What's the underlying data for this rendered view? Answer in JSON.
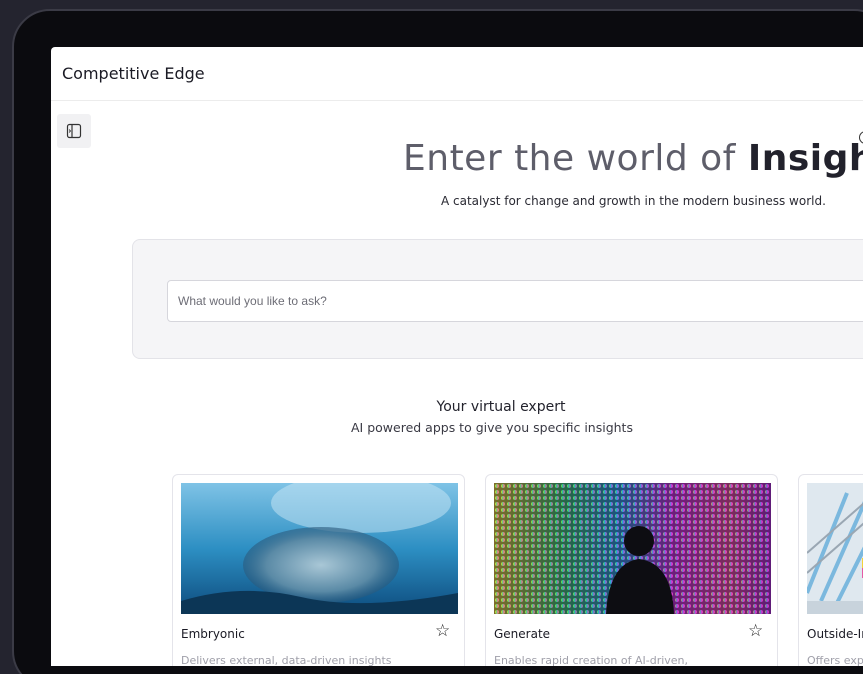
{
  "app": {
    "title": "Competitive Edge"
  },
  "sidebar": {
    "toggle_icon": "sidebar-panel-icon"
  },
  "hero": {
    "title_prefix": "Enter the world of ",
    "title_emphasis": "Insights",
    "info_icon": "info-icon",
    "info_glyph": "i",
    "subtitle": "A catalyst for change and growth in the modern business world."
  },
  "search": {
    "placeholder": "What would you like to ask?",
    "value": ""
  },
  "section": {
    "title": "Your virtual expert",
    "subtitle": "AI powered apps to give you specific insights"
  },
  "cards": [
    {
      "name": "Embryonic",
      "description": "Delivers external, data-driven insights",
      "favorite_icon": "star-outline-icon",
      "star_glyph": "☆"
    },
    {
      "name": "Generate",
      "description": "Enables rapid creation of AI-driven,",
      "favorite_icon": "star-outline-icon",
      "star_glyph": "☆"
    },
    {
      "name": "Outside-In V",
      "description": "Offers expans",
      "favorite_icon": "star-outline-icon",
      "star_glyph": "☆"
    }
  ]
}
